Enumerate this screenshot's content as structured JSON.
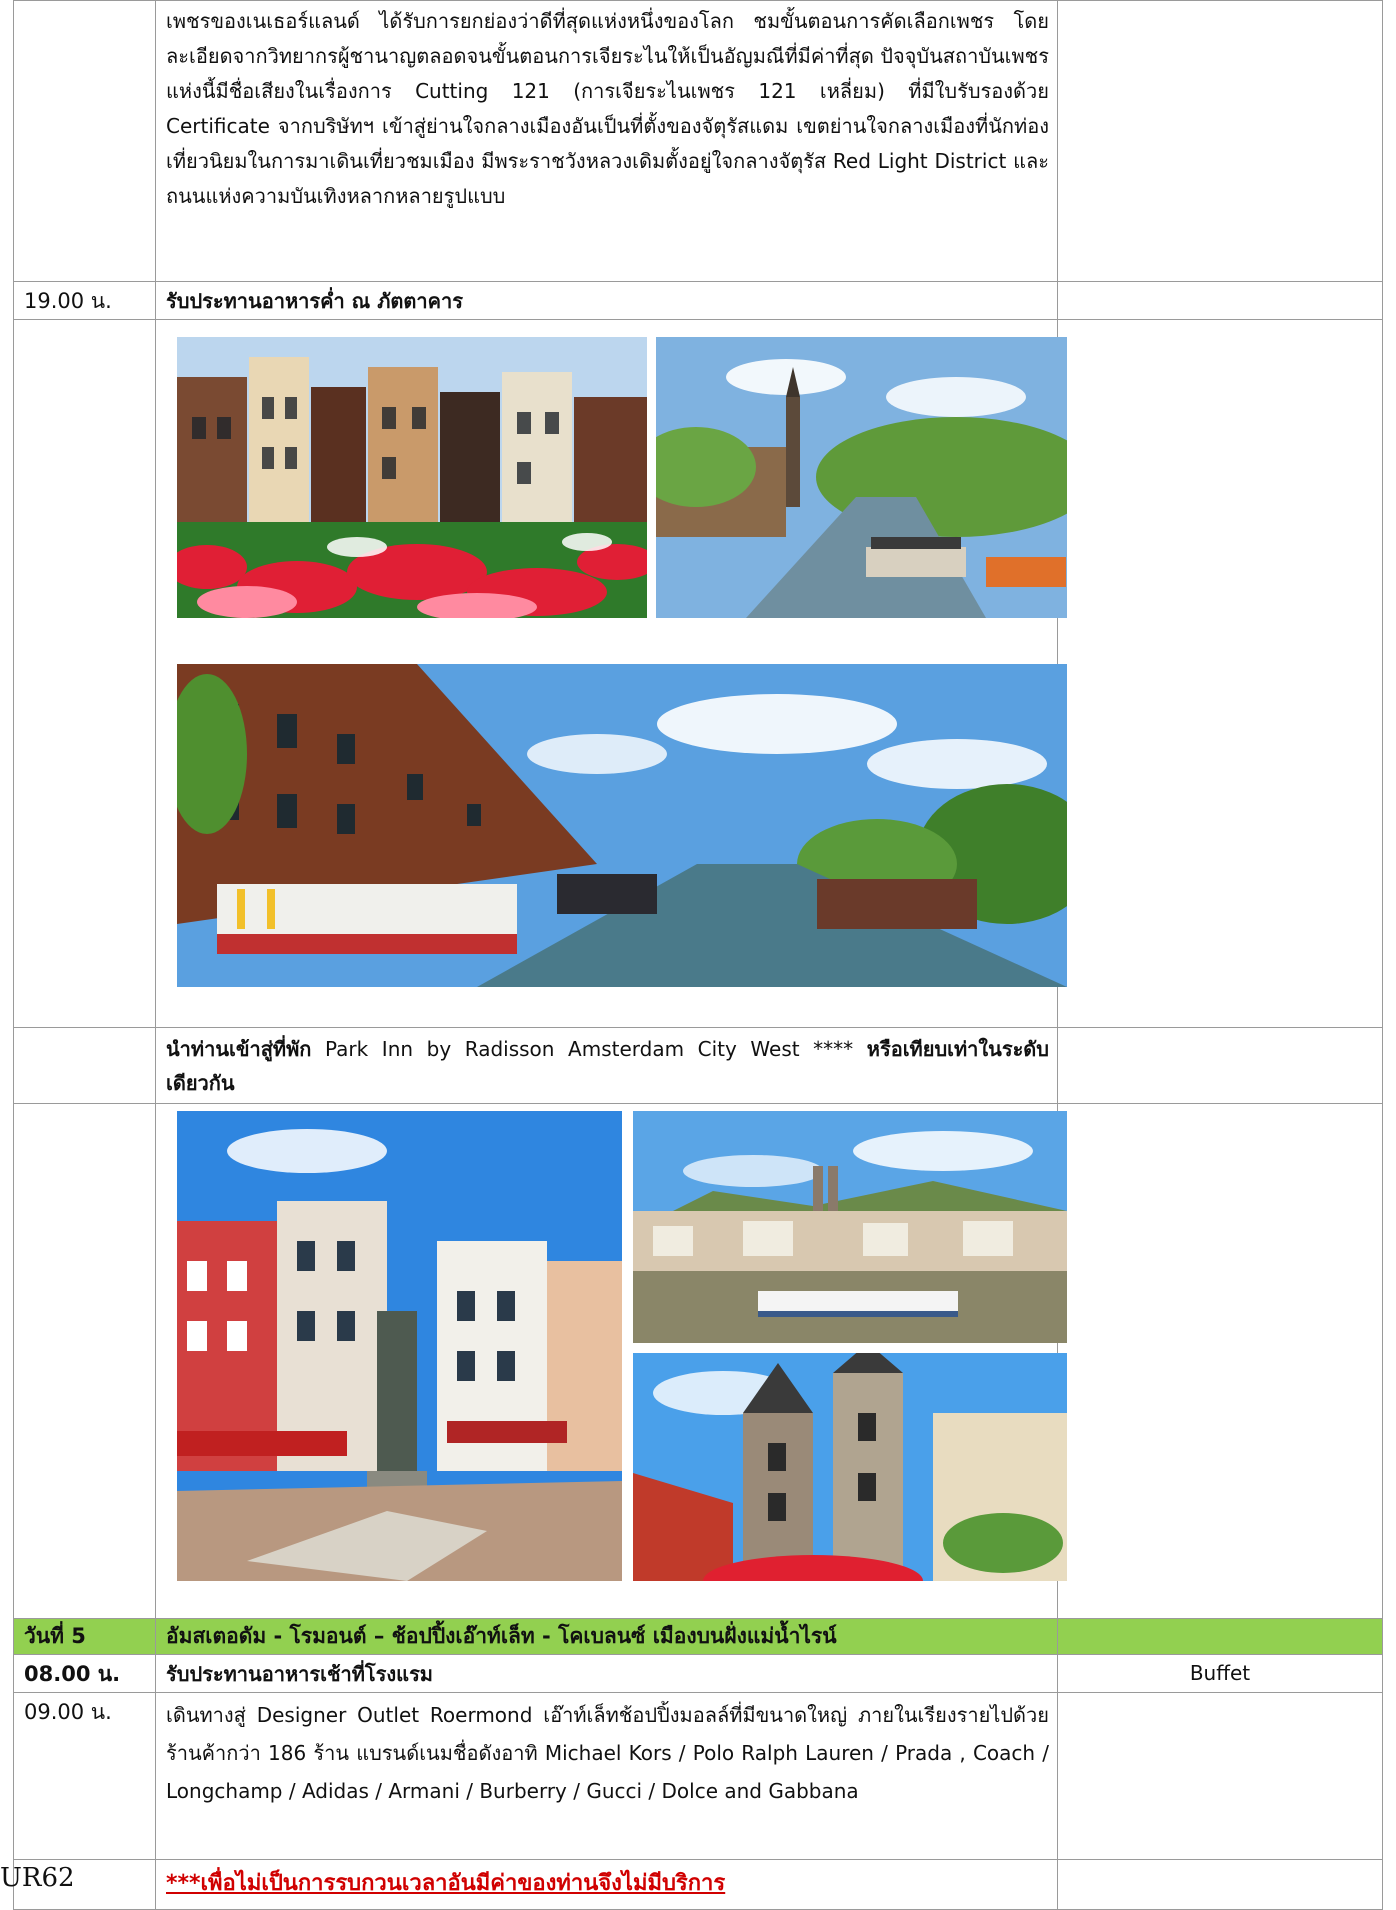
{
  "intro_paragraph": "เพชรของเนเธอร์แลนด์ ได้รับการยกย่องว่าดีที่สุดแห่งหนึ่งของโลก ชมขั้นตอนการคัดเลือกเพชร โดยละเอียดจากวิทยากรผู้ชานาญตลอดจนขั้นตอนการเจียระไนให้เป็นอัญมณีที่มีค่าที่สุด ปัจจุบันสถาบันเพชรแห่งนี้มีชื่อเสียงในเรื่องการ Cutting 121 (การเจียระไนเพชร 121 เหลี่ยม) ที่มีใบรับรองด้วย Certificate จากบริษัทฯ เข้าสู่ย่านใจกลางเมืองอันเป็นที่ตั้งของจัตุรัสแดม เขตย่านใจกลางเมืองที่นักท่องเที่ยวนิยมในการมาเดินเที่ยวชมเมือง มีพระราชวังหลวงเดิมตั้งอยู่ใจกลางจัตุรัส Red Light District และถนนแห่งความบันเทิงหลากหลายรูปแบบ",
  "dinner": {
    "time": "19.00 น.",
    "text": "รับประทานอาหารค่ำ ณ ภัตตาคาร"
  },
  "hotel": {
    "prefix": "นำท่านเข้าสู่ที่พัก",
    "name": " Park Inn by Radisson Amsterdam City West **** ",
    "suffix": "หรือเทียบเท่าในระดับเดียวกัน"
  },
  "day5": {
    "label": "วันที่ 5",
    "title": "อัมสเตอดัม - โรมอนต์ – ช้อปปิ้งเอ๊าท์เล็ท - โคเบลนซ์ เมืองบนฝั่งแม่น้ำไรน์"
  },
  "breakfast": {
    "time": "08.00 น.",
    "text": "รับประทานอาหารเช้าที่โรงแรม",
    "meal": "Buffet"
  },
  "outlet": {
    "time": "09.00 น.",
    "text": "เดินทางสู่ Designer Outlet Roermond เอ๊าท์เล็ทช้อปปิ้งมอลล์ที่มีขนาดใหญ่ ภายในเรียงรายไปด้วยร้านค้ากว่า 186 ร้าน แบรนด์เนมชื่อดังอาทิ Michael Kors / Polo Ralph Lauren / Prada , Coach / Longchamp / Adidas / Armani / Burberry / Gucci / Dolce and Gabbana"
  },
  "notice": "***เพื่อไม่เป็นการรบกวนเวลาอันมีค่าของท่านจึงไม่มีบริการ",
  "footer_code": "UR62",
  "colors": {
    "day_header_bg": "#92d050",
    "notice_red": "#d00000",
    "border": "#9a9a9a"
  },
  "images": [
    "amsterdam-tulips-houses",
    "amsterdam-canal-tower",
    "amsterdam-canal-boats",
    "koblenz-square-statue",
    "koblenz-rhine-river",
    "koblenz-church-towers"
  ]
}
